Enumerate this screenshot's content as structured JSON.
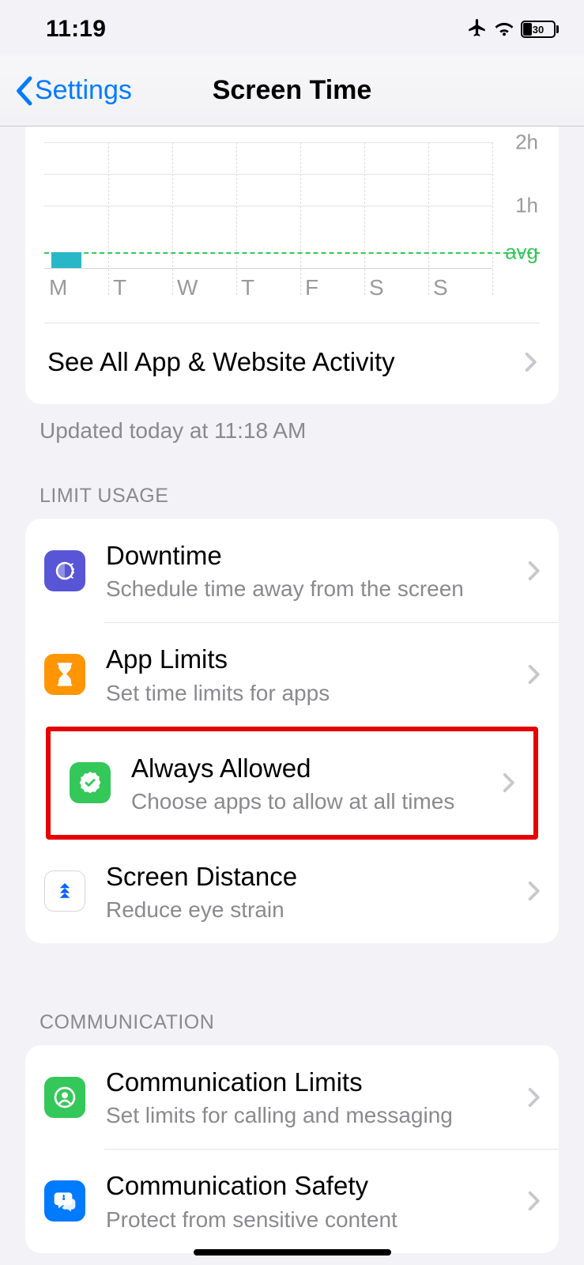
{
  "status": {
    "time": "11:19",
    "battery_pct": "30",
    "battery_fill_pct": 30
  },
  "nav": {
    "back": "Settings",
    "title": "Screen Time"
  },
  "chart_data": {
    "type": "bar",
    "categories": [
      "M",
      "T",
      "W",
      "T",
      "F",
      "S",
      "S"
    ],
    "values": [
      0.25,
      0,
      0,
      0,
      0,
      0,
      0
    ],
    "ylim": [
      0,
      2
    ],
    "yticks": [
      1,
      2
    ],
    "ytick_labels": [
      "1h",
      "2h"
    ],
    "avg": 0.25,
    "avg_label": "avg"
  },
  "activity": {
    "see_all": "See All App & Website Activity",
    "updated": "Updated today at 11:18 AM"
  },
  "sections": {
    "limit_usage": {
      "label": "LIMIT USAGE",
      "downtime": {
        "title": "Downtime",
        "sub": "Schedule time away from the screen"
      },
      "app_limits": {
        "title": "App Limits",
        "sub": "Set time limits for apps"
      },
      "always_allowed": {
        "title": "Always Allowed",
        "sub": "Choose apps to allow at all times"
      },
      "screen_distance": {
        "title": "Screen Distance",
        "sub": "Reduce eye strain"
      }
    },
    "communication": {
      "label": "COMMUNICATION",
      "limits": {
        "title": "Communication Limits",
        "sub": "Set limits for calling and messaging"
      },
      "safety": {
        "title": "Communication Safety",
        "sub": "Protect from sensitive content"
      }
    }
  }
}
